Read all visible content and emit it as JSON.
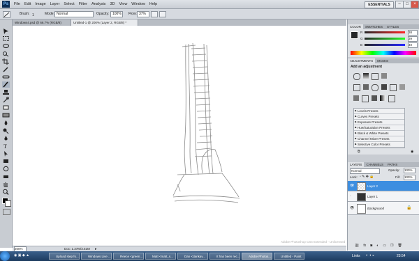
{
  "app": {
    "logo": "Ps",
    "workspace": "ESSENTIALS"
  },
  "menu": [
    "File",
    "Edit",
    "Image",
    "Layer",
    "Select",
    "Filter",
    "Analysis",
    "3D",
    "View",
    "Window",
    "Help"
  ],
  "options": {
    "brush_label": "Brush:",
    "brush_size": "1",
    "mode_label": "Mode:",
    "mode_value": "Normal",
    "opacity_label": "Opacity:",
    "opacity_value": "100%",
    "flow_label": "Flow:",
    "flow_value": "37%"
  },
  "documents": [
    {
      "title": "Windows4.psd @ 66.7% (RGB/8)"
    },
    {
      "title": "Untitled-1 @ 200% (Layer 2, RGB/8) *"
    }
  ],
  "status": {
    "zoom": "200%",
    "doc": "Doc: 1.37M/3.51M"
  },
  "color_panel": {
    "tabs": [
      "COLOR",
      "SWATCHES",
      "STYLES"
    ],
    "r_label": "R",
    "r": "38",
    "g_label": "G",
    "g": "39",
    "b_label": "B",
    "b": "40"
  },
  "adjustments_panel": {
    "tabs": [
      "ADJUSTMENTS",
      "MASKS"
    ],
    "title": "Add an adjustment",
    "presets": [
      "Levels Presets",
      "Curves Presets",
      "Exposure Presets",
      "Hue/Saturation Presets",
      "Black & White Presets",
      "Channel Mixer Presets",
      "Selective Color Presets"
    ]
  },
  "layers_panel": {
    "tabs": [
      "LAYERS",
      "CHANNELS",
      "PATHS"
    ],
    "blend_mode": "Normal",
    "opacity_label": "Opacity:",
    "opacity": "100%",
    "lock_label": "Lock:",
    "fill_label": "Fill:",
    "fill": "100%",
    "layers": [
      {
        "name": "Layer 2",
        "selected": true
      },
      {
        "name": "Layer 1",
        "selected": false
      },
      {
        "name": "Background",
        "selected": false
      }
    ]
  },
  "watermark": "Adobe Photoshop CS4 Extended - Unlicensed",
  "taskbar": {
    "tasks": [
      "Upload step fo...",
      "Windows Live ...",
      "Reece <green...",
      "Matt <matt_s...",
      "Dan <dankav...",
      "It has been rec...",
      "Adobe Photos...",
      "Untitled - Paint"
    ],
    "active_index": 6,
    "links_label": "Links",
    "clock": "23:54"
  },
  "colors": {
    "selection": "#3d8ee0",
    "taskbar": "#1c3a5e"
  }
}
